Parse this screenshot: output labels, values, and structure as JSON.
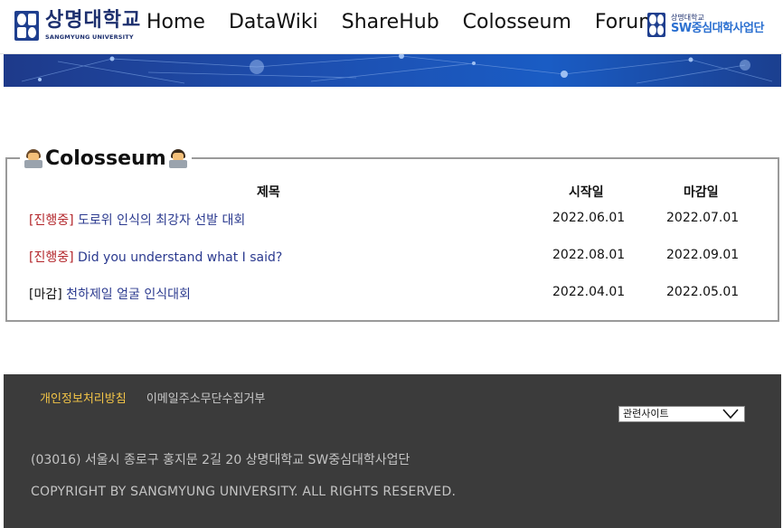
{
  "header": {
    "logo": {
      "ko": "상명대학교",
      "en": "SANGMYUNG UNIVERSITY"
    },
    "nav": [
      "Home",
      "DataWiki",
      "ShareHub",
      "Colosseum",
      "Forum"
    ],
    "sw_logo": {
      "small": "상명대학교",
      "big": "SW중심대학사업단"
    }
  },
  "board": {
    "title": "Colosseum",
    "columns": {
      "title": "제목",
      "start": "시작일",
      "end": "마감일"
    },
    "rows": [
      {
        "status": "[진행중]",
        "title": "도로위 인식의 최강자 선발 대회",
        "start": "2022.06.01",
        "end": "2022.07.01"
      },
      {
        "status": "[진행중]",
        "title": "Did you understand what I said?",
        "start": "2022.08.01",
        "end": "2022.09.01"
      },
      {
        "status": "[마감]",
        "title": "천하제일 얼굴 인식대회",
        "start": "2022.04.01",
        "end": "2022.05.01"
      }
    ]
  },
  "footer": {
    "links": [
      "개인정보처리방침",
      "이메일주소무단수집거부"
    ],
    "related_sites": "관련사이트",
    "address": "(03016) 서울시 종로구 홍지문 2길 20 상명대학교 SW중심대학사업단",
    "copyright": "COPYRIGHT BY SANGMYUNG UNIVERSITY. ALL RIGHTS RESERVED."
  }
}
